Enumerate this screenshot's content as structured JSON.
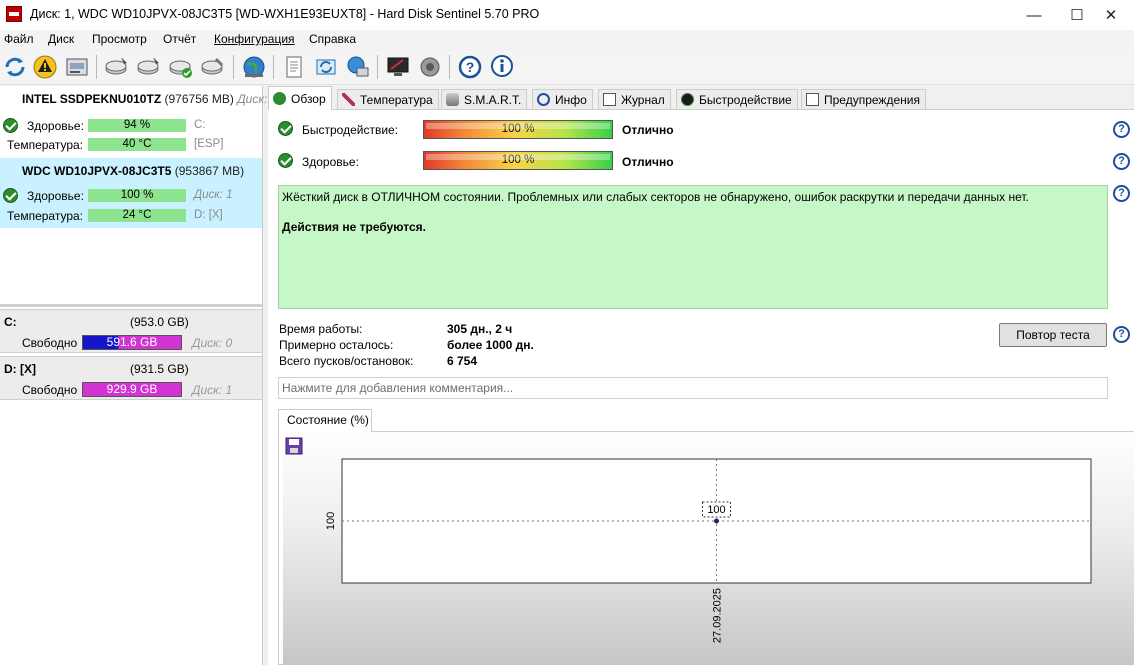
{
  "window": {
    "title": "Диск: 1, WDC WD10JPVX-08JC3T5 [WD-WXH1E93EUXT8]  -  Hard Disk Sentinel 5.70 PRO",
    "minimize": "—",
    "maximize": "☐",
    "close": "✕"
  },
  "menu": [
    "Файл",
    "Диск",
    "Просмотр",
    "Отчёт",
    "Конфигурация",
    "Справка"
  ],
  "toolbar": {
    "icons": [
      "refresh-icon",
      "alert-icon",
      "disk-icon",
      "disk-test-icon",
      "disk-surface-icon",
      "disk-check-icon",
      "disk-repair-icon",
      "globe-icon",
      "report-icon",
      "send-report-icon",
      "network-icon",
      "monitor-icon",
      "sound-icon",
      "help-icon",
      "info-icon"
    ]
  },
  "disks": [
    {
      "name": "INTEL SSDPEKNU010TZ",
      "size": "(976756 MB)",
      "tail": "Диск:",
      "health_label": "Здоровье:",
      "health": "94 %",
      "health_note": "C:",
      "temp_label": "Температура:",
      "temp": "40 °C",
      "temp_note": "[ESP]"
    },
    {
      "name": "WDC WD10JPVX-08JC3T5",
      "size": "(953867 MB)",
      "health_label": "Здоровье:",
      "health": "100 %",
      "health_note": "Диск: 1",
      "temp_label": "Температура:",
      "temp": "24 °C",
      "temp_note": "D: [X]"
    }
  ],
  "volumes": [
    {
      "letter": "C:",
      "size": "(953.0 GB)",
      "free_label": "Свободно",
      "free": "591.6 GB",
      "note": "Диск: 0"
    },
    {
      "letter": "D: [X]",
      "size": "(931.5 GB)",
      "free_label": "Свободно",
      "free": "929.9 GB",
      "note": "Диск: 1"
    }
  ],
  "tabs": [
    "Обзор",
    "Температура",
    "S.M.A.R.T.",
    "Инфо",
    "Журнал",
    "Быстродействие",
    "Предупреждения"
  ],
  "overview": {
    "performance": {
      "label": "Быстродействие:",
      "value": "100 %",
      "level": 100,
      "rating": "Отлично"
    },
    "health": {
      "label": "Здоровье:",
      "value": "100 %",
      "level": 100,
      "rating": "Отлично"
    },
    "status_text": "Жёсткий диск в ОТЛИЧНОМ состоянии. Проблемных или слабых секторов не обнаружено, ошибок раскрутки и передачи данных нет.",
    "status_action": "Действия не требуются.",
    "stats": [
      {
        "label": "Время работы:",
        "value": "305 дн., 2 ч"
      },
      {
        "label": "Примерно осталось:",
        "value": "более 1000 дн."
      },
      {
        "label": "Всего пусков/остановок:",
        "value": "6 754"
      }
    ],
    "retest_button": "Повтор теста",
    "comment_placeholder": "Нажмите для добавления комментария..."
  },
  "chart_tab": "Состояние (%)",
  "chart_data": {
    "type": "line",
    "title": "Состояние (%)",
    "x": [
      "27.09.2025"
    ],
    "series": [
      {
        "values": [
          100
        ]
      }
    ],
    "data_labels": [
      "100"
    ],
    "y_ticks": [
      "100"
    ],
    "x_ticks": [
      "27.09.2025"
    ],
    "grid": true
  }
}
